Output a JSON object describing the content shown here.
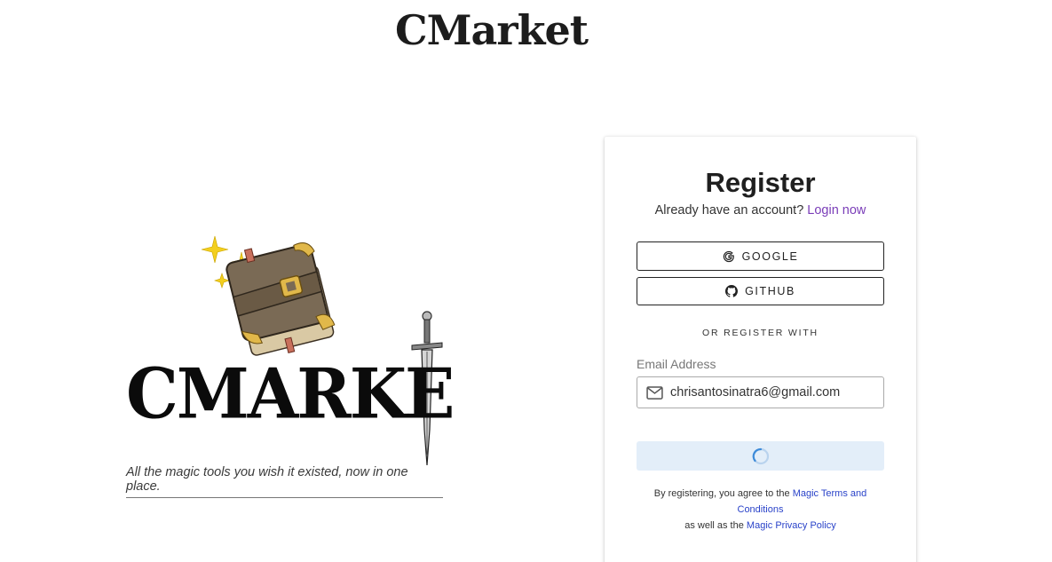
{
  "header": {
    "brand": "CMarket"
  },
  "hero": {
    "logo_text": "CMARKE",
    "tagline": "All the magic tools you wish it existed, now in one place."
  },
  "register": {
    "title": "Register",
    "have_account_text": "Already have an account?",
    "login_link": "Login now",
    "google_label": "GOOGLE",
    "github_label": "GITHUB",
    "divider": "OR REGISTER WITH",
    "email_label": "Email Address",
    "email_value": "chrisantosinatra6@gmail.com",
    "submit_state": "loading",
    "legal_prefix": "By registering, you agree to the",
    "terms_link": "Magic Terms and Conditions",
    "legal_middle": "as well as the",
    "privacy_link": "Magic Privacy Policy"
  },
  "colors": {
    "accent_link": "#7a3db8",
    "legal_link": "#2a43c9",
    "submit_bg": "#e3eef9",
    "spinner": "#3d8bd9"
  }
}
